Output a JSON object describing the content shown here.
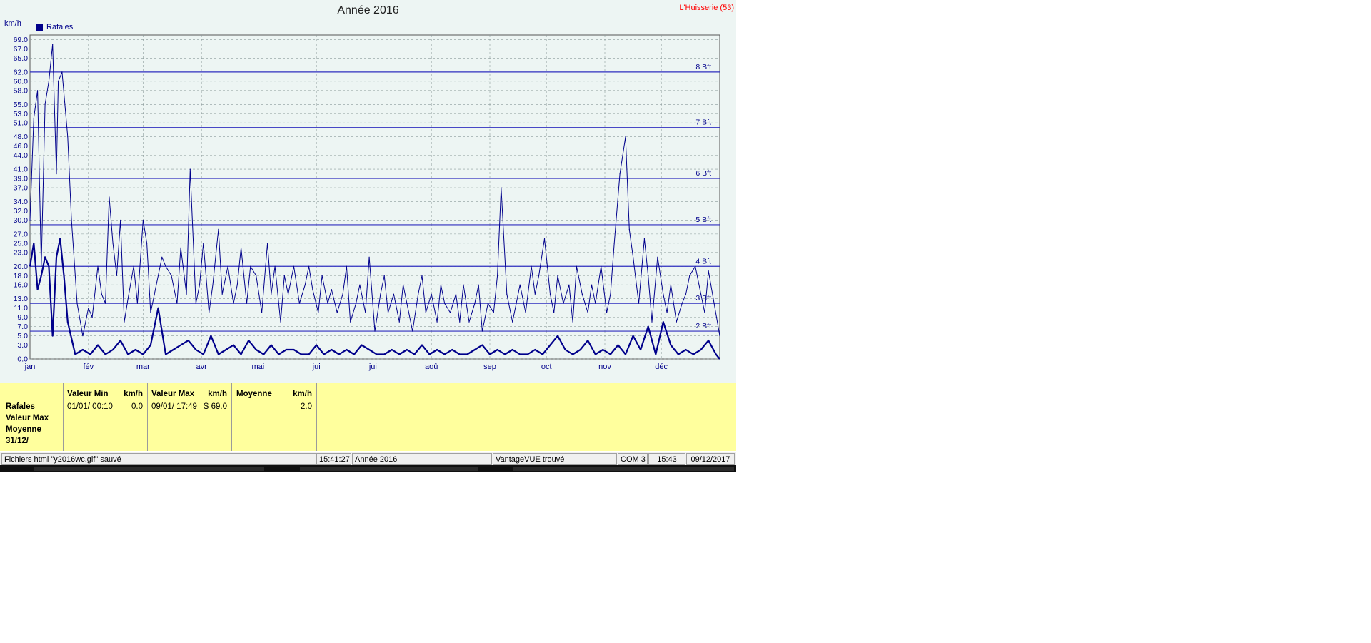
{
  "window": {
    "title": "Année 2016",
    "station": "L'Huisserie (53)"
  },
  "chart_data": {
    "type": "line",
    "title": "Année 2016",
    "ylabel": "km/h",
    "ylim": [
      0,
      70
    ],
    "grid": true,
    "legend": {
      "placement": "top-left",
      "entries": [
        "Rafales"
      ]
    },
    "y_ticks": [
      "0.0",
      "3.0",
      "5.0",
      "7.0",
      "9.0",
      "11.0",
      "13.0",
      "16.0",
      "18.0",
      "20.0",
      "23.0",
      "25.0",
      "27.0",
      "30.0",
      "32.0",
      "34.0",
      "37.0",
      "39.0",
      "41.0",
      "44.0",
      "46.0",
      "48.0",
      "51.0",
      "53.0",
      "55.0",
      "58.0",
      "60.0",
      "62.0",
      "65.0",
      "67.0",
      "69.0"
    ],
    "x_ticks": [
      "jan",
      "fév",
      "mar",
      "avr",
      "mai",
      "jui",
      "jui",
      "aoû",
      "sep",
      "oct",
      "nov",
      "déc"
    ],
    "beaufort": [
      {
        "label": "2 Bft",
        "value": 6
      },
      {
        "label": "3 Bft",
        "value": 12
      },
      {
        "label": "4 Bft",
        "value": 20
      },
      {
        "label": "5 Bft",
        "value": 29
      },
      {
        "label": "6 Bft",
        "value": 39
      },
      {
        "label": "7 Bft",
        "value": 50
      },
      {
        "label": "8 Bft",
        "value": 62
      }
    ],
    "series": [
      {
        "name": "Rafales",
        "x": [
          0,
          2,
          4,
          6,
          8,
          10,
          12,
          14,
          15,
          17,
          20,
          22,
          25,
          28,
          31,
          33,
          36,
          38,
          40,
          42,
          44,
          46,
          48,
          50,
          52,
          55,
          57,
          60,
          62,
          64,
          66,
          68,
          70,
          72,
          75,
          78,
          80,
          83,
          85,
          88,
          90,
          92,
          95,
          97,
          100,
          102,
          105,
          108,
          110,
          112,
          115,
          117,
          120,
          123,
          126,
          128,
          130,
          133,
          135,
          137,
          140,
          143,
          146,
          148,
          150,
          153,
          155,
          158,
          160,
          163,
          166,
          168,
          170,
          173,
          175,
          178,
          180,
          183,
          186,
          188,
          190,
          193,
          196,
          198,
          200,
          203,
          206,
          208,
          210,
          213,
          216,
          218,
          220,
          223,
          226,
          228,
          230,
          233,
          236,
          238,
          240,
          243,
          246,
          248,
          250,
          253,
          256,
          258,
          260,
          263,
          266,
          268,
          270,
          273,
          276,
          278,
          280,
          283,
          286,
          288,
          290,
          293,
          296,
          298,
          300,
          303,
          306,
          308,
          310,
          313,
          316,
          318,
          320,
          323,
          326,
          328,
          330,
          333,
          336,
          338,
          340,
          343,
          346,
          348,
          350,
          353,
          356,
          358,
          360,
          363,
          366
        ],
        "values": [
          30,
          52,
          58,
          20,
          55,
          60,
          68,
          40,
          60,
          62,
          48,
          30,
          12,
          5,
          11,
          9,
          20,
          14,
          12,
          35,
          25,
          18,
          30,
          8,
          13,
          20,
          12,
          30,
          25,
          10,
          14,
          18,
          22,
          20,
          18,
          12,
          24,
          14,
          41,
          12,
          16,
          25,
          10,
          16,
          28,
          14,
          20,
          12,
          16,
          24,
          12,
          20,
          18,
          10,
          25,
          14,
          20,
          8,
          18,
          14,
          20,
          12,
          16,
          20,
          15,
          10,
          18,
          12,
          15,
          10,
          14,
          20,
          8,
          12,
          16,
          10,
          22,
          6,
          14,
          18,
          10,
          14,
          8,
          16,
          12,
          6,
          14,
          18,
          10,
          14,
          8,
          16,
          12,
          10,
          14,
          8,
          16,
          8,
          12,
          16,
          6,
          12,
          10,
          18,
          37,
          14,
          8,
          12,
          16,
          10,
          20,
          14,
          18,
          26,
          14,
          10,
          18,
          12,
          16,
          8,
          20,
          14,
          10,
          16,
          12,
          20,
          10,
          14,
          25,
          40,
          48,
          28,
          22,
          12,
          26,
          18,
          8,
          22,
          14,
          10,
          16,
          8,
          12,
          14,
          18,
          20,
          14,
          10,
          19,
          12,
          5
        ]
      },
      {
        "name": "Moyenne",
        "x": [
          0,
          2,
          4,
          6,
          8,
          10,
          12,
          14,
          16,
          18,
          20,
          24,
          28,
          32,
          36,
          40,
          44,
          48,
          52,
          56,
          60,
          64,
          68,
          72,
          76,
          80,
          84,
          88,
          92,
          96,
          100,
          104,
          108,
          112,
          116,
          120,
          124,
          128,
          132,
          136,
          140,
          144,
          148,
          152,
          156,
          160,
          164,
          168,
          172,
          176,
          180,
          184,
          188,
          192,
          196,
          200,
          204,
          208,
          212,
          216,
          220,
          224,
          228,
          232,
          236,
          240,
          244,
          248,
          252,
          256,
          260,
          264,
          268,
          272,
          276,
          280,
          284,
          288,
          292,
          296,
          300,
          304,
          308,
          312,
          316,
          320,
          324,
          328,
          332,
          336,
          340,
          344,
          348,
          352,
          356,
          360,
          364,
          366
        ],
        "values": [
          20,
          25,
          15,
          18,
          22,
          20,
          5,
          22,
          26,
          18,
          8,
          1,
          2,
          1,
          3,
          1,
          2,
          4,
          1,
          2,
          1,
          3,
          11,
          1,
          2,
          3,
          4,
          2,
          1,
          5,
          1,
          2,
          3,
          1,
          4,
          2,
          1,
          3,
          1,
          2,
          2,
          1,
          1,
          3,
          1,
          2,
          1,
          2,
          1,
          3,
          2,
          1,
          1,
          2,
          1,
          2,
          1,
          3,
          1,
          2,
          1,
          2,
          1,
          1,
          2,
          3,
          1,
          2,
          1,
          2,
          1,
          1,
          2,
          1,
          3,
          5,
          2,
          1,
          2,
          4,
          1,
          2,
          1,
          3,
          1,
          5,
          2,
          7,
          1,
          8,
          3,
          1,
          2,
          1,
          2,
          4,
          1,
          0
        ]
      }
    ]
  },
  "stats": {
    "row_labels": [
      "Rafales",
      "Valeur Max",
      "Moyenne",
      "31/12/"
    ],
    "columns": [
      {
        "header": "Valeur Min",
        "unit": "km/h",
        "date": "01/01/  00:10",
        "value": "0.0"
      },
      {
        "header": "Valeur Max",
        "unit": "km/h",
        "date": "09/01/  17:49",
        "value": "S 69.0"
      },
      {
        "header": "Moyenne",
        "unit": "km/h",
        "date": "",
        "value": "2.0"
      }
    ]
  },
  "statusbar": {
    "message": "Fichiers html  \"y2016wc.gif\"  sauvé",
    "time1": "15:41:27",
    "period": "Année 2016",
    "station": "VantageVUE trouvé",
    "port": "COM 3",
    "time2": "15:43",
    "date": "09/12/2017"
  },
  "colors": {
    "series": "#00008b",
    "bft_line": "#2f2fbf",
    "grid": "#8a9a9a",
    "panel_bg": "#edf5f3",
    "stats_bg": "#ffff9d",
    "station": "#ff0000"
  }
}
